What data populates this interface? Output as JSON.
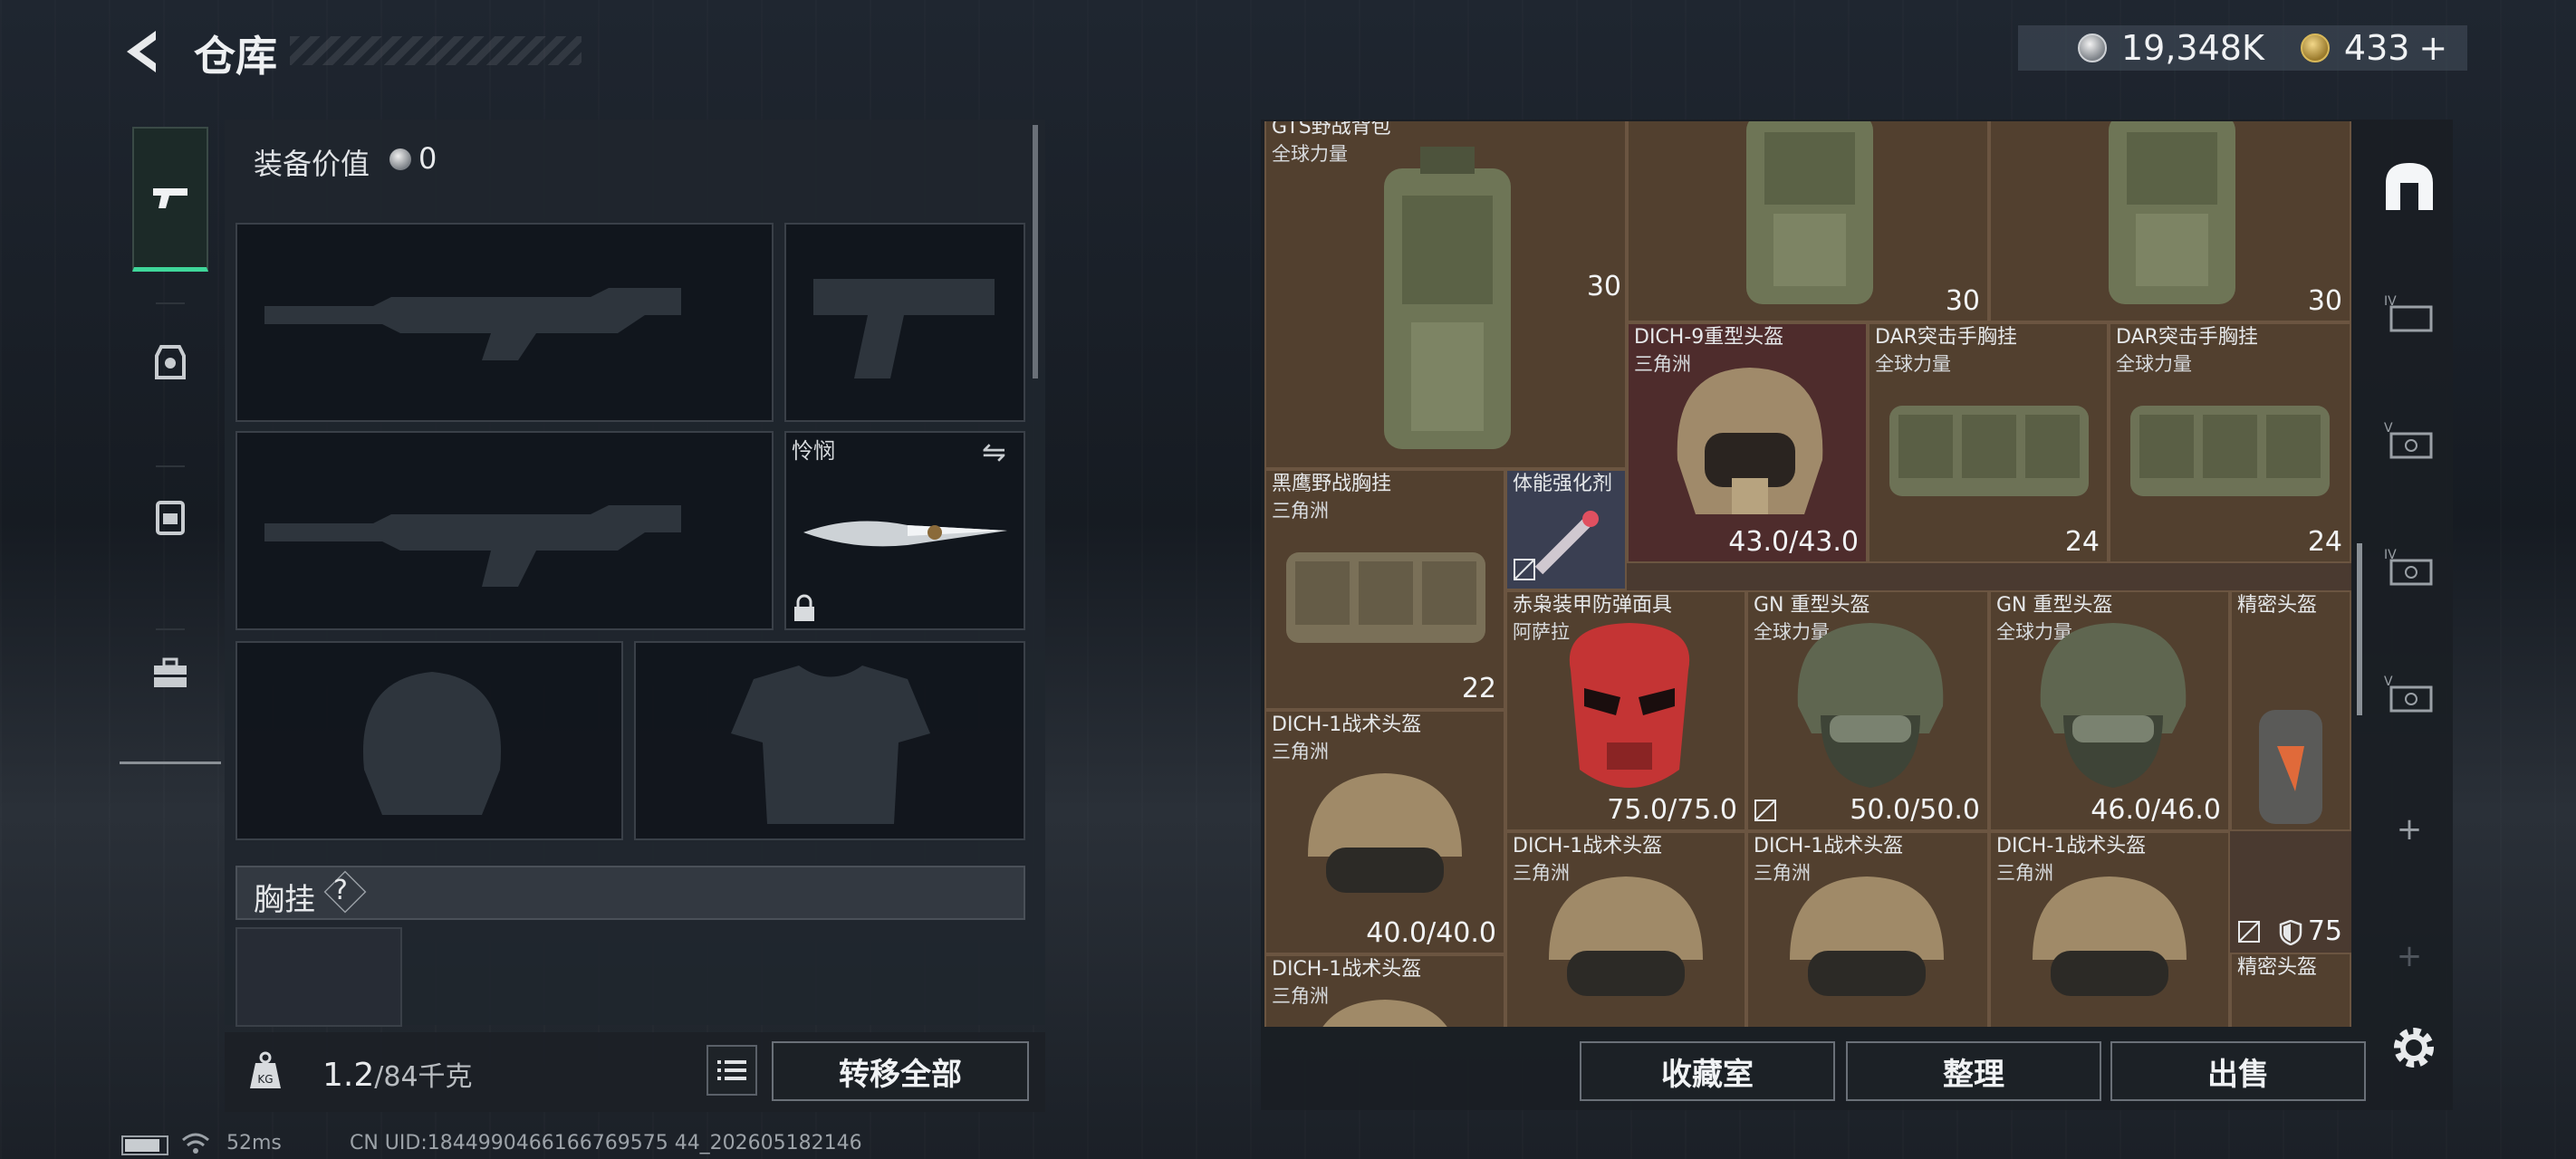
{
  "header": {
    "title": "仓库",
    "silver_amount": "19,348K",
    "gold_amount": "433",
    "gold_plus": "+"
  },
  "loadout": {
    "equip_value_label": "装备价值",
    "equip_value": "0",
    "melee_name": "怜悯",
    "chest_label": "胸挂",
    "chest_help": "?"
  },
  "footer_left": {
    "weight_current": "1.2",
    "weight_max": "/84千克",
    "transfer_all": "转移全部"
  },
  "storage": {
    "items": [
      {
        "name": "GTS野战背包",
        "sub": "全球力量",
        "val": ""
      },
      {
        "name": "",
        "sub": "",
        "cnt": "30"
      },
      {
        "name": "",
        "sub": "",
        "cnt": "30"
      },
      {
        "name": "",
        "sub": "",
        "cnt": "30"
      },
      {
        "name": "DICH-9重型头盔",
        "sub": "三角洲",
        "val": "43.0/43.0"
      },
      {
        "name": "DAR突击手胸挂",
        "sub": "全球力量",
        "cnt": "24"
      },
      {
        "name": "DAR突击手胸挂",
        "sub": "全球力量",
        "cnt": "24"
      },
      {
        "name": "黑鹰野战胸挂",
        "sub": "三角洲",
        "cnt": "22"
      },
      {
        "name": "体能强化剂",
        "sub": "",
        "val": ""
      },
      {
        "name": "赤枭装甲防弹面具",
        "sub": "阿萨拉",
        "val": "75.0/75.0"
      },
      {
        "name": "GN 重型头盔",
        "sub": "全球力量",
        "val": "50.0/50.0"
      },
      {
        "name": "GN 重型头盔",
        "sub": "全球力量",
        "val": "46.0/46.0"
      },
      {
        "name": "精密头盔",
        "sub": "",
        "val": ""
      },
      {
        "name": "DICH-1战术头盔",
        "sub": "三角洲",
        "val": "40.0/40.0"
      },
      {
        "name": "DICH-1战术头盔",
        "sub": "三角洲",
        "val": ""
      },
      {
        "name": "DICH-1战术头盔",
        "sub": "三角洲",
        "val": ""
      },
      {
        "name": "DICH-1战术头盔",
        "sub": "三角洲",
        "val": ""
      },
      {
        "name": "",
        "sub": "",
        "cnt": "75"
      },
      {
        "name": "DICH-1战术头盔",
        "sub": "三角洲",
        "val": ""
      },
      {
        "name": "精密头盔",
        "sub": "",
        "val": ""
      }
    ]
  },
  "footer_right": {
    "collection": "收藏室",
    "organize": "整理",
    "sell": "出售"
  },
  "status": {
    "ping": "52ms",
    "uid": "CN UID:1844990466166769575 44_202605182146"
  },
  "colors": {
    "accent": "#3fd69a",
    "item_bg": "#52402f",
    "red_item_bg": "#4e2c2c"
  }
}
